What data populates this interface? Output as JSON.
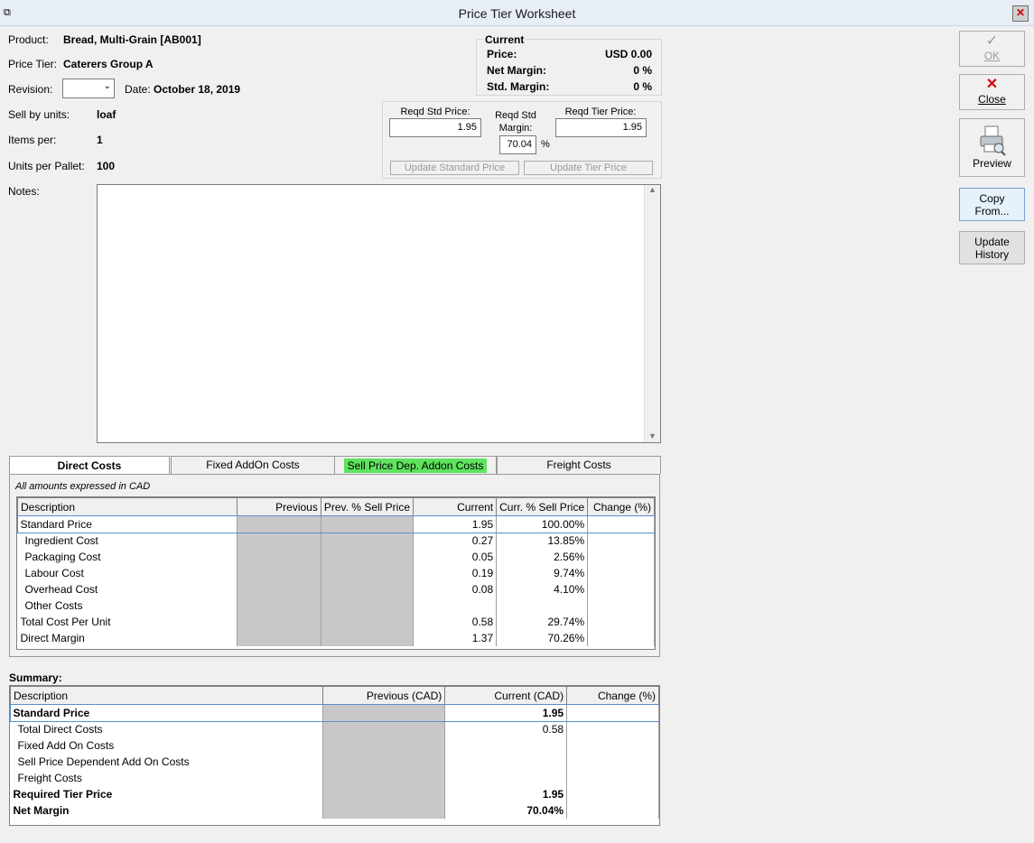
{
  "window": {
    "title": "Price Tier Worksheet",
    "close_glyph": "✕"
  },
  "product": {
    "product_label": "Product:",
    "product_value": "Bread, Multi-Grain [AB001]",
    "tier_label": "Price Tier:",
    "tier_value": "Caterers Group A",
    "revision_label": "Revision:",
    "revision_value": "",
    "date_label": "Date:",
    "date_value": "October 18, 2019",
    "sell_units_label": "Sell by units:",
    "sell_units_value": "loaf",
    "items_per_label": "Items per:",
    "items_per_value": "1",
    "units_pallet_label": "Units per Pallet:",
    "units_pallet_value": "100",
    "notes_label": "Notes:",
    "notes_value": ""
  },
  "current": {
    "heading": "Current",
    "price_label": "Price:",
    "price_value": "USD 0.00",
    "net_margin_label": "Net Margin:",
    "net_margin_value": "0 %",
    "std_margin_label": "Std. Margin:",
    "std_margin_value": "0 %"
  },
  "required": {
    "std_price_label": "Reqd Std Price:",
    "std_price_value": "1.95",
    "std_margin_label_1": "Reqd Std",
    "std_margin_label_2": "Margin:",
    "std_margin_value": "70.04",
    "percent": "%",
    "tier_price_label": "Reqd Tier Price:",
    "tier_price_value": "1.95",
    "update_std_button": "Update Standard Price",
    "update_tier_button": "Update Tier Price"
  },
  "side_buttons": {
    "ok": "OK",
    "close": "Close",
    "preview": "Preview",
    "copy_1": "Copy",
    "copy_2": "From...",
    "history_1": "Update",
    "history_2": "History"
  },
  "tabs": [
    {
      "label": "Direct Costs",
      "active": true
    },
    {
      "label": "Fixed AddOn Costs",
      "active": false
    },
    {
      "label": "Sell Price Dep. Addon Costs",
      "active": false,
      "highlight": "#5fe35f"
    },
    {
      "label": "Freight Costs",
      "active": false
    }
  ],
  "direct_costs": {
    "note": "All amounts expressed in CAD",
    "columns": [
      "Description",
      "Previous",
      "Prev. % Sell Price",
      "Current",
      "Curr. % Sell Price",
      "Change (%)"
    ],
    "rows": [
      {
        "desc": "Standard Price",
        "prev": "",
        "prev_pct": "",
        "curr": "1.95",
        "curr_pct": "100.00%",
        "change": ""
      },
      {
        "desc": "Ingredient Cost",
        "prev": "",
        "prev_pct": "",
        "curr": "0.27",
        "curr_pct": "13.85%",
        "change": ""
      },
      {
        "desc": "Packaging Cost",
        "prev": "",
        "prev_pct": "",
        "curr": "0.05",
        "curr_pct": "2.56%",
        "change": ""
      },
      {
        "desc": "Labour Cost",
        "prev": "",
        "prev_pct": "",
        "curr": "0.19",
        "curr_pct": "9.74%",
        "change": ""
      },
      {
        "desc": "Overhead Cost",
        "prev": "",
        "prev_pct": "",
        "curr": "0.08",
        "curr_pct": "4.10%",
        "change": ""
      },
      {
        "desc": "Other Costs",
        "prev": "",
        "prev_pct": "",
        "curr": "",
        "curr_pct": "",
        "change": ""
      },
      {
        "desc": "Total Cost Per Unit",
        "prev": "",
        "prev_pct": "",
        "curr": "0.58",
        "curr_pct": "29.74%",
        "change": ""
      },
      {
        "desc": "Direct Margin",
        "prev": "",
        "prev_pct": "",
        "curr": "1.37",
        "curr_pct": "70.26%",
        "change": ""
      }
    ]
  },
  "summary": {
    "heading": "Summary:",
    "columns": [
      "Description",
      "Previous (CAD)",
      "Current (CAD)",
      "Change (%)"
    ],
    "rows": [
      {
        "desc": "Standard Price",
        "prev": "",
        "curr": "1.95",
        "change": ""
      },
      {
        "desc": "Total Direct Costs",
        "prev": "",
        "curr": "0.58",
        "change": ""
      },
      {
        "desc": "Fixed Add On Costs",
        "prev": "",
        "curr": "",
        "change": ""
      },
      {
        "desc": "Sell Price Dependent Add On Costs",
        "prev": "",
        "curr": "",
        "change": ""
      },
      {
        "desc": "Freight Costs",
        "prev": "",
        "curr": "",
        "change": ""
      },
      {
        "desc": "Required Tier Price",
        "prev": "",
        "curr": "1.95",
        "change": ""
      },
      {
        "desc": "Net Margin",
        "prev": "",
        "curr": "70.04%",
        "change": ""
      }
    ]
  }
}
